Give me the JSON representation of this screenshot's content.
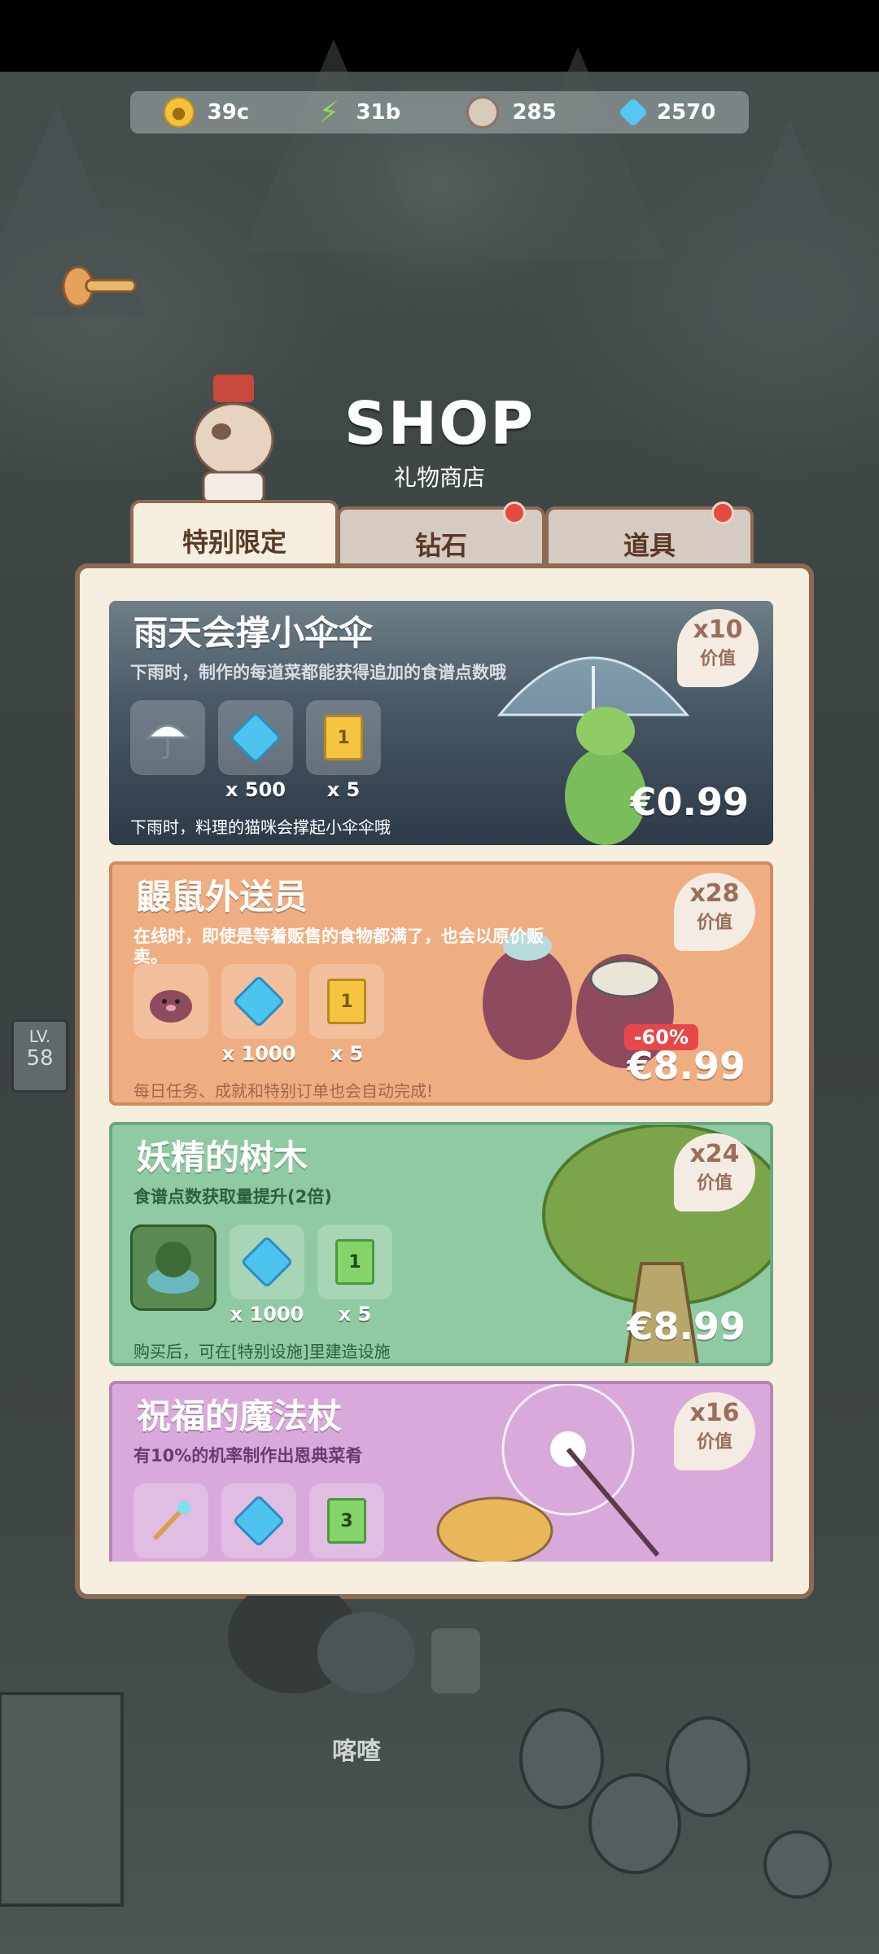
{
  "resources": [
    {
      "icon": "coin-icon",
      "value": "39c"
    },
    {
      "icon": "bolt-icon",
      "value": "31b"
    },
    {
      "icon": "gear-icon",
      "value": "285"
    },
    {
      "icon": "gem-icon",
      "value": "2570"
    }
  ],
  "header": {
    "title": "SHOP",
    "subtitle": "礼物商店"
  },
  "tabs": [
    {
      "label": "特别限定",
      "active": true
    },
    {
      "label": "钻石",
      "badge": true
    },
    {
      "label": "道具",
      "badge": true
    }
  ],
  "cards": [
    {
      "title": "雨天会撑小伞伞",
      "desc": "下雨时，制作的每道菜都能获得追加的食谱点数哦",
      "items": [
        {
          "icon": "umbrella-icon",
          "qty": ""
        },
        {
          "icon": "gem-icon",
          "qty": "x 500"
        },
        {
          "icon": "ticket-icon",
          "qty": "x 5"
        }
      ],
      "foot": "下雨时，料理的猫咪会撑起小伞伞哦",
      "value_mult": "x10",
      "value_label": "价值",
      "price": "€0.99"
    },
    {
      "title": "鼹鼠外送员",
      "desc": "在线时，即使是等着贩售的食物都满了，也会以原价贩卖。",
      "items": [
        {
          "icon": "mole-icon",
          "qty": ""
        },
        {
          "icon": "gem-icon",
          "qty": "x 1000"
        },
        {
          "icon": "ticket-icon",
          "qty": "x 5"
        }
      ],
      "foot": "每日任务、成就和特别订单也会自动完成!",
      "value_mult": "x28",
      "value_label": "价值",
      "discount": "-60%",
      "price": "€8.99"
    },
    {
      "title": "妖精的树木",
      "desc": "食谱点数获取量提升(2倍)",
      "items": [
        {
          "icon": "tree-icon",
          "qty": ""
        },
        {
          "icon": "gem-icon",
          "qty": "x 1000"
        },
        {
          "icon": "ticket-green-icon",
          "qty": "x 5"
        }
      ],
      "foot": "购买后，可在[特别设施]里建造设施",
      "value_mult": "x24",
      "value_label": "价值",
      "price": "€8.99"
    },
    {
      "title": "祝福的魔法杖",
      "desc": "有10%的机率制作出恩典菜肴",
      "items": [
        {
          "icon": "wand-icon",
          "qty": ""
        },
        {
          "icon": "gem-icon",
          "qty": ""
        },
        {
          "icon": "ticket-green-icon",
          "qty": ""
        }
      ],
      "value_mult": "x16",
      "value_label": "价值"
    }
  ],
  "side": {
    "lv_label": "LV.",
    "lv_value": "58"
  },
  "sound": "喀喳"
}
